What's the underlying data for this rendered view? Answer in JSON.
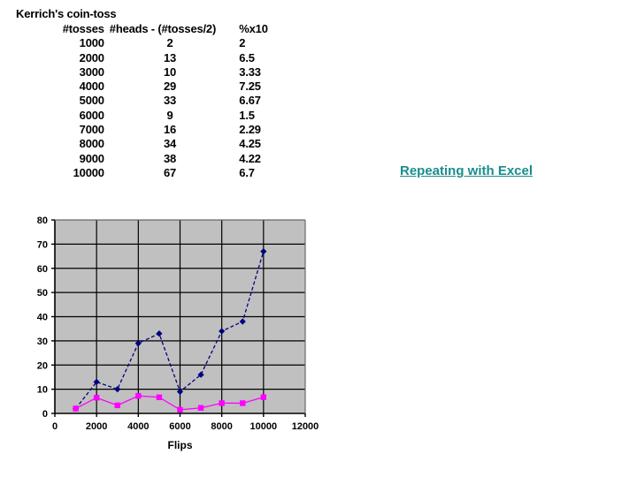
{
  "slide": {
    "background": "#ffffff"
  },
  "table": {
    "title": "Kerrich's coin-toss",
    "headers": [
      "#tosses",
      "#heads - (#tosses/2)",
      "%x10"
    ],
    "rows": [
      [
        "1000",
        "2",
        "2"
      ],
      [
        "2000",
        "13",
        "6.5"
      ],
      [
        "3000",
        "10",
        "3.33"
      ],
      [
        "4000",
        "29",
        "7.25"
      ],
      [
        "5000",
        "33",
        "6.67"
      ],
      [
        "6000",
        "9",
        "1.5"
      ],
      [
        "7000",
        "16",
        "2.29"
      ],
      [
        "8000",
        "34",
        "4.25"
      ],
      [
        "9000",
        "38",
        "4.22"
      ],
      [
        "10000",
        "67",
        "6.7"
      ]
    ]
  },
  "link": {
    "label": "Repeating with Excel",
    "color": "#1a8c8c"
  },
  "chart_data": {
    "type": "line",
    "title": "",
    "xlabel": "Flips",
    "ylabel": "",
    "x": [
      1000,
      2000,
      3000,
      4000,
      5000,
      6000,
      7000,
      8000,
      9000,
      10000
    ],
    "series": [
      {
        "name": "#heads - (#tosses/2)",
        "color": "#000080",
        "marker": "diamond",
        "linestyle": "dashed",
        "values": [
          2,
          13,
          10,
          29,
          33,
          9,
          16,
          34,
          38,
          67
        ]
      },
      {
        "name": "%x10",
        "color": "#ff00ff",
        "marker": "square",
        "linestyle": "solid",
        "values": [
          2,
          6.5,
          3.33,
          7.25,
          6.67,
          1.5,
          2.29,
          4.25,
          4.22,
          6.7
        ]
      }
    ],
    "xlim": [
      0,
      12000
    ],
    "ylim": [
      0,
      80
    ],
    "xticks": [
      0,
      2000,
      4000,
      6000,
      8000,
      10000,
      12000
    ],
    "yticks": [
      0,
      10,
      20,
      30,
      40,
      50,
      60,
      70,
      80
    ],
    "xtick_labels": [
      "0",
      "2000",
      "4000",
      "6000",
      "8000",
      "10000",
      "12000"
    ],
    "ytick_labels": [
      "0",
      "10",
      "20",
      "30",
      "40",
      "50",
      "60",
      "70",
      "80"
    ],
    "grid": true,
    "plot_background": "#c0c0c0",
    "grid_color": "#000000",
    "legend": "none"
  }
}
